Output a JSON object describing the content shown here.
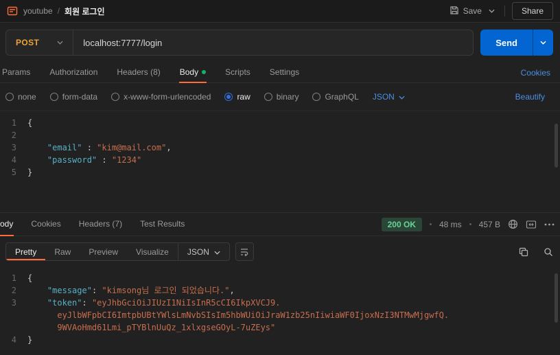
{
  "colors": {
    "accent_orange": "#ff6c37",
    "send_button_blue": "#0265d2",
    "method_post_orange": "#eba439",
    "link_blue": "#4a90e2",
    "status_green": "#69d39a",
    "json_key_teal": "#59b0c6",
    "json_string_rust": "#c76e4e",
    "active_dot_green": "#15b06c"
  },
  "topbar": {
    "breadcrumb": {
      "parent": "youtube",
      "separator": "/",
      "current": "회원 로그인"
    },
    "save_label": "Save",
    "share_label": "Share"
  },
  "request": {
    "method": "POST",
    "url": "localhost:7777/login",
    "send_label": "Send"
  },
  "request_tabs": {
    "items": [
      {
        "label": "Params"
      },
      {
        "label": "Authorization"
      },
      {
        "label": "Headers (8)"
      },
      {
        "label": "Body"
      },
      {
        "label": "Scripts"
      },
      {
        "label": "Settings"
      }
    ],
    "cookies_label": "Cookies"
  },
  "body_options": {
    "items": [
      {
        "label": "none"
      },
      {
        "label": "form-data"
      },
      {
        "label": "x-www-form-urlencoded"
      },
      {
        "label": "raw"
      },
      {
        "label": "binary"
      },
      {
        "label": "GraphQL"
      }
    ],
    "selected": "raw",
    "language": "JSON",
    "beautify_label": "Beautify"
  },
  "request_editor": {
    "lines": [
      {
        "num": "1",
        "segments": [
          {
            "c": "punct",
            "t": "{"
          }
        ]
      },
      {
        "num": "2",
        "segments": []
      },
      {
        "num": "3",
        "segments": [
          {
            "c": "plain",
            "t": "    "
          },
          {
            "c": "key",
            "t": "\"email\""
          },
          {
            "c": "punct",
            "t": " : "
          },
          {
            "c": "str",
            "t": "\"kim@mail.com\""
          },
          {
            "c": "punct",
            "t": ","
          }
        ]
      },
      {
        "num": "4",
        "segments": [
          {
            "c": "plain",
            "t": "    "
          },
          {
            "c": "key",
            "t": "\"password\""
          },
          {
            "c": "punct",
            "t": " : "
          },
          {
            "c": "str",
            "t": "\"1234\""
          }
        ]
      },
      {
        "num": "5",
        "segments": [
          {
            "c": "punct",
            "t": "}"
          }
        ]
      }
    ]
  },
  "response": {
    "tabs": [
      {
        "label": "Body"
      },
      {
        "label": "Cookies"
      },
      {
        "label": "Headers (7)"
      },
      {
        "label": "Test Results"
      }
    ],
    "status": {
      "code_text": "200 OK",
      "time": "48 ms",
      "size": "457 B"
    },
    "views": [
      {
        "label": "Pretty"
      },
      {
        "label": "Raw"
      },
      {
        "label": "Preview"
      },
      {
        "label": "Visualize"
      }
    ],
    "language": "JSON",
    "editor": {
      "lines": [
        {
          "num": "1",
          "segments": [
            {
              "c": "punct",
              "t": "{"
            }
          ]
        },
        {
          "num": "2",
          "segments": [
            {
              "c": "plain",
              "t": "    "
            },
            {
              "c": "key",
              "t": "\"message\""
            },
            {
              "c": "punct",
              "t": ": "
            },
            {
              "c": "str",
              "t": "\"kimsong님 로그인 되었습니다.\""
            },
            {
              "c": "punct",
              "t": ","
            }
          ]
        },
        {
          "num": "3",
          "segments": [
            {
              "c": "plain",
              "t": "    "
            },
            {
              "c": "key",
              "t": "\"token\""
            },
            {
              "c": "punct",
              "t": ": "
            },
            {
              "c": "str",
              "t": "\"eyJhbGciOiJIUzI1NiIsInR5cCI6IkpXVCJ9."
            }
          ]
        },
        {
          "num": "",
          "segments": [
            {
              "c": "plain",
              "t": "      "
            },
            {
              "c": "str",
              "t": "eyJlbWFpbCI6ImtpbUBtYWlsLmNvbSIsIm5hbWUiOiJraW1zb25nIiwiaWF0IjoxNzI3NTMwMjgwfQ."
            }
          ]
        },
        {
          "num": "",
          "segments": [
            {
              "c": "plain",
              "t": "      "
            },
            {
              "c": "str",
              "t": "9WVAoHmd61Lmi_pTYBlnUuQz_1xlxgseGOyL-7uZEys\""
            }
          ]
        },
        {
          "num": "4",
          "segments": [
            {
              "c": "punct",
              "t": "}"
            }
          ]
        }
      ]
    }
  }
}
